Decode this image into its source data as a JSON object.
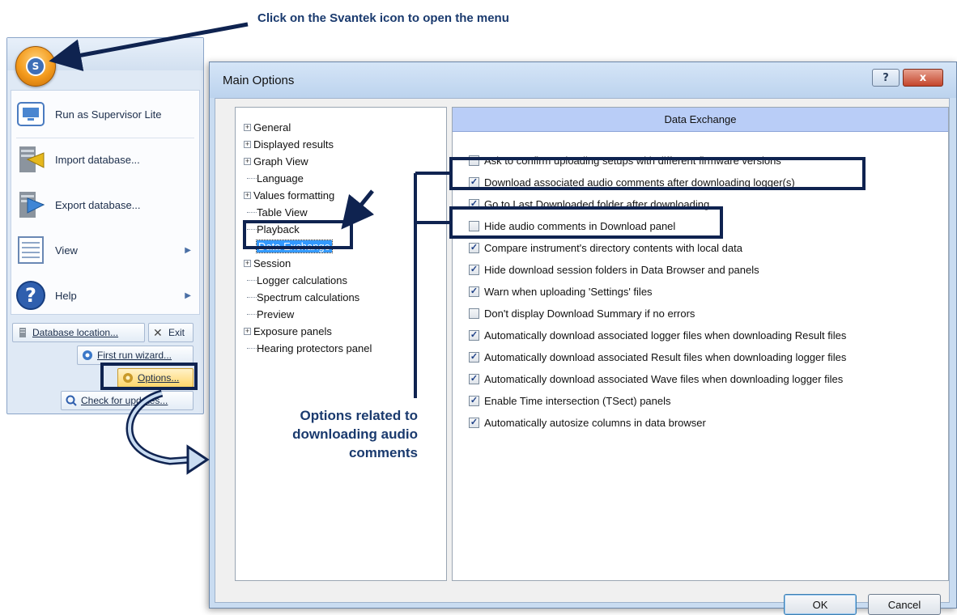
{
  "annotations": {
    "top_callout": "Click on the Svantek icon to open the menu",
    "side_callout": "Options related to downloading audio comments"
  },
  "app_menu": {
    "items": [
      {
        "label": "Run as Supervisor Lite",
        "icon": "monitor-icon"
      },
      {
        "label": "Import database...",
        "icon": "import-icon"
      },
      {
        "label": "Export database...",
        "icon": "export-icon"
      },
      {
        "label": "View",
        "icon": "view-icon"
      },
      {
        "label": "Help",
        "icon": "help-icon"
      }
    ],
    "database_location": "Database location...",
    "exit": "Exit",
    "first_run_wizard": "First run wizard...",
    "options": "Options...",
    "check_updates": "Check for updates..."
  },
  "dialog": {
    "title": "Main Options",
    "help_glyph": "?",
    "close_glyph": "x",
    "tree": [
      {
        "label": "General",
        "expandable": true
      },
      {
        "label": "Displayed results",
        "expandable": true
      },
      {
        "label": "Graph View",
        "expandable": true
      },
      {
        "label": "Language",
        "expandable": false
      },
      {
        "label": "Values formatting",
        "expandable": true
      },
      {
        "label": "Table View",
        "expandable": false
      },
      {
        "label": "Playback",
        "expandable": false
      },
      {
        "label": "Data Exchange",
        "expandable": false,
        "selected": true
      },
      {
        "label": "Session",
        "expandable": true
      },
      {
        "label": "Logger calculations",
        "expandable": false
      },
      {
        "label": "Spectrum calculations",
        "expandable": false
      },
      {
        "label": "Preview",
        "expandable": false
      },
      {
        "label": "Exposure panels",
        "expandable": true
      },
      {
        "label": "Hearing protectors panel",
        "expandable": false
      }
    ],
    "panel_title": "Data Exchange",
    "options": [
      {
        "label": "Ask to confirm uploading setups with different firmware versions",
        "checked": false
      },
      {
        "label": "Download associated audio comments after downloading logger(s)",
        "checked": true
      },
      {
        "label": "Go to Last Downloaded folder after downloading",
        "checked": true
      },
      {
        "label": "Hide audio comments in Download panel",
        "checked": false
      },
      {
        "label": "Compare instrument's directory contents with local data",
        "checked": true
      },
      {
        "label": "Hide download session folders in Data Browser and panels",
        "checked": true
      },
      {
        "label": "Warn when uploading 'Settings' files",
        "checked": true
      },
      {
        "label": "Don't display Download Summary if no errors",
        "checked": false
      },
      {
        "label": "Automatically download associated logger files when downloading Result files",
        "checked": true
      },
      {
        "label": "Automatically download associated Result files when downloading logger files",
        "checked": true
      },
      {
        "label": "Automatically download associated Wave files when downloading logger files",
        "checked": true
      },
      {
        "label": "Enable Time intersection (TSect) panels",
        "checked": true
      },
      {
        "label": "Automatically autosize columns in data browser",
        "checked": true
      }
    ],
    "ok": "OK",
    "cancel": "Cancel"
  },
  "colors": {
    "annotation": "#0f2350",
    "selection": "#3399ff",
    "panel_header": "#b9cdf7"
  }
}
